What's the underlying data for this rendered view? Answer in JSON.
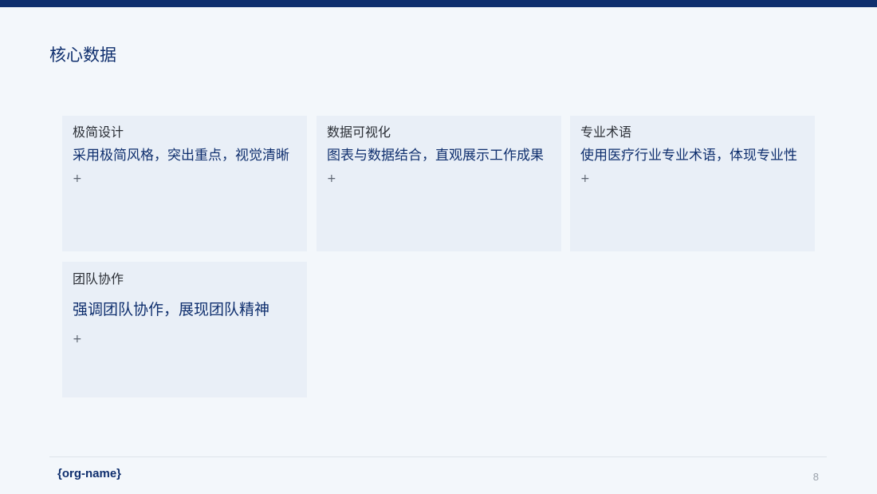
{
  "slide": {
    "title": "核心数据",
    "cards": [
      {
        "heading": "极简设计",
        "body": "采用极简风格，突出重点，视觉清晰",
        "plus": "+"
      },
      {
        "heading": "数据可视化",
        "body": "图表与数据结合，直观展示工作成果",
        "plus": "+"
      },
      {
        "heading": "专业术语",
        "body": "使用医疗行业专业术语，体现专业性",
        "plus": "+"
      },
      {
        "heading": "团队协作",
        "body": "强调团队协作，展现团队精神",
        "plus": "+"
      }
    ]
  },
  "footer": {
    "org": "{org-name}",
    "page_number": "8"
  },
  "colors": {
    "accent": "#0f2f6e",
    "background": "#f3f7fb",
    "card": "#e9eff7"
  }
}
